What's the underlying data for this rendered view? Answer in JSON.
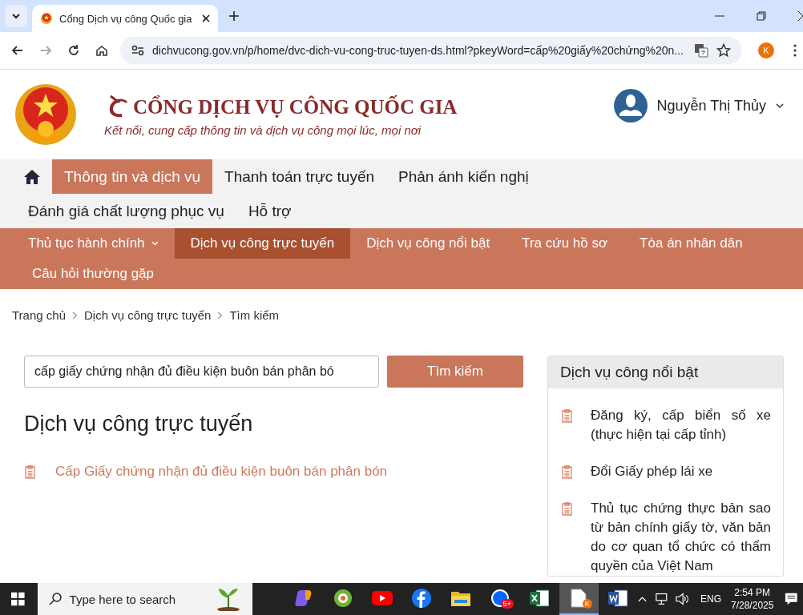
{
  "browser": {
    "tab_title": "Cổng Dịch vụ công Quốc gia",
    "url": "dichvucong.gov.vn/p/home/dvc-dich-vu-cong-truc-tuyen-ds.html?pkeyWord=cấp%20giấy%20chứng%20n...",
    "profile_initial": "K"
  },
  "header": {
    "title": "CỔNG DỊCH VỤ CÔNG QUỐC GIA",
    "tagline": "Kết nối, cung cấp thông tin và dịch vụ công mọi lúc, mọi nơi",
    "user_name": "Nguyễn Thị Thủy"
  },
  "main_nav": [
    {
      "label": "Thông tin và dịch vụ",
      "selected": true
    },
    {
      "label": "Thanh toán trực tuyến",
      "selected": false
    },
    {
      "label": "Phản ánh kiến nghị",
      "selected": false
    },
    {
      "label": "Đánh giá chất lượng phục vụ",
      "selected": false
    },
    {
      "label": "Hỗ trợ",
      "selected": false
    }
  ],
  "sub_nav": [
    {
      "label": "Thủ tục hành chính",
      "selected": false,
      "expandable": true
    },
    {
      "label": "Dịch vụ công trực tuyến",
      "selected": true,
      "expandable": false
    },
    {
      "label": "Dịch vụ công nổi bật",
      "selected": false,
      "expandable": false
    },
    {
      "label": "Tra cứu hồ sơ",
      "selected": false,
      "expandable": false
    },
    {
      "label": "Tòa án nhân dân",
      "selected": false,
      "expandable": false
    },
    {
      "label": "Câu hỏi thường gặp",
      "selected": false,
      "expandable": false
    }
  ],
  "breadcrumb": [
    "Trang chủ",
    "Dịch vụ công trực tuyến",
    "Tìm kiếm"
  ],
  "search": {
    "value": "cấp giấy chứng nhận đủ điều kiện buôn bán phân bó",
    "button": "Tìm kiếm"
  },
  "results": {
    "heading": "Dịch vụ công trực tuyến",
    "items": [
      "Cấp Giấy chứng nhận đủ điều kiện buôn bán phân bón"
    ]
  },
  "sidebar": {
    "title": "Dịch vụ công nổi bật",
    "items": [
      "Đăng ký, cấp biển số xe (thực hiện tại cấp tỉnh)",
      "Đổi Giấy phép lái xe",
      "Thủ tục chứng thực bản sao từ bản chính giấy tờ, văn bản do cơ quan tổ chức có thẩm quyền của Việt Nam"
    ]
  },
  "taskbar": {
    "search_placeholder": "Type here to search",
    "apps": [
      {
        "kind": "copilot",
        "selected": false
      },
      {
        "kind": "browser",
        "selected": false
      },
      {
        "kind": "youtube",
        "selected": false
      },
      {
        "kind": "facebook",
        "selected": false
      },
      {
        "kind": "folder",
        "selected": false
      },
      {
        "kind": "chat",
        "selected": false,
        "badge": "5+"
      },
      {
        "kind": "excel",
        "selected": false
      },
      {
        "kind": "file",
        "selected": true,
        "badge": "K"
      },
      {
        "kind": "word",
        "selected": false
      }
    ],
    "language": "ENG",
    "time": "2:54 PM",
    "date": "7/28/2025"
  }
}
